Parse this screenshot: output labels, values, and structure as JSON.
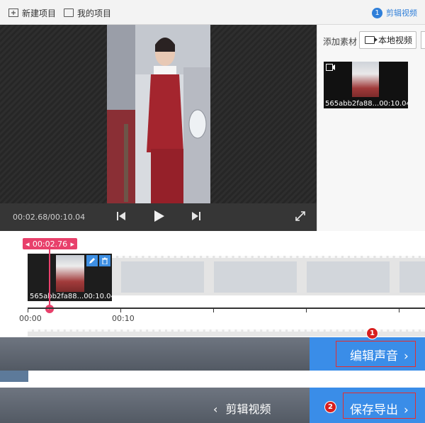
{
  "toolbar": {
    "new_project": "新建项目",
    "my_projects": "我的项目",
    "step_number": "1",
    "step_label": "剪辑视频"
  },
  "player": {
    "time": "00:02.68/00:10.04"
  },
  "media_panel": {
    "add_label": "添加素材",
    "local_video_button": "本地视频",
    "thumb_name": "565abb2fa88...",
    "thumb_duration": "00:10.04"
  },
  "timeline": {
    "playhead_time": "00:02.76",
    "clip_name": "565abb2fa88...",
    "clip_duration": "00:10.04",
    "ruler_labels": [
      "00:00",
      "00:10"
    ]
  },
  "bottom": {
    "edit_audio_label": "编辑声音",
    "back_label": "剪辑视频",
    "export_label": "保存导出",
    "marker_1": "1",
    "marker_2": "2"
  },
  "colors": {
    "accent": "#3a8de8",
    "playhead": "#e8406b",
    "highlight": "#e52d2d"
  }
}
